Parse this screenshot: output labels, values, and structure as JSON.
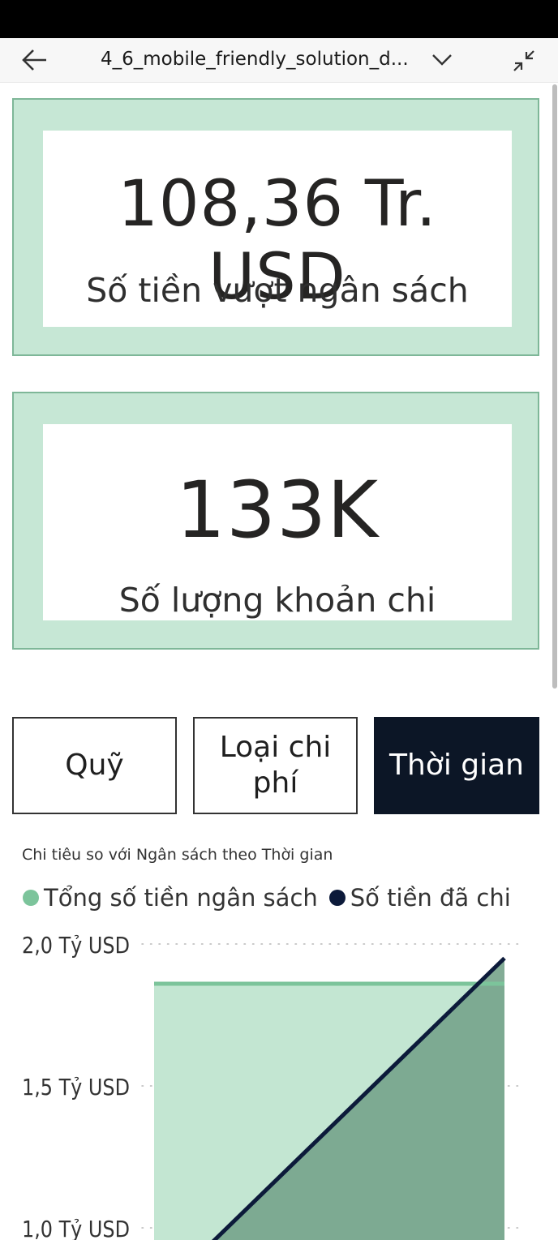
{
  "app": {
    "title": "4_6_mobile_friendly_solution_d...",
    "icons": {
      "back": "back-arrow-icon",
      "dropdown": "chevron-down-icon",
      "collapse": "collapse-icon"
    }
  },
  "kpis": [
    {
      "value": "108,36 Tr. USD",
      "label": "Số tiền vượt ngân sách"
    },
    {
      "value": "133K",
      "label": "Số lượng khoản chi"
    }
  ],
  "tabs": [
    {
      "label": "Quỹ",
      "active": false
    },
    {
      "label": "Loại chi phí",
      "active": false
    },
    {
      "label": "Thời gian",
      "active": true
    }
  ],
  "colors": {
    "card_bg": "#c6e7d5",
    "card_border": "#7eb798",
    "active_tab": "#0c1626",
    "budget": "#7cc49b",
    "spent": "#0c1a3a",
    "budget_fill": "#c3e6d2",
    "overlap_fill": "#76a38b"
  },
  "chart_data": {
    "type": "area",
    "title": "Chi tiêu so với Ngân sách theo Thời gian",
    "legend_position": "top-left",
    "y_tick_labels": [
      "2,0 Tỷ USD",
      "1,5 Tỷ USD",
      "1,0 Tỷ USD"
    ],
    "y_ticks": [
      2.0,
      1.5,
      1.0
    ],
    "y_visible_range": [
      0.97,
      2.05
    ],
    "gridlines": "dotted",
    "x_range": [
      0,
      1
    ],
    "series": [
      {
        "name": "Tổng số tiền ngân sách",
        "color": "#7cc49b",
        "points": [
          [
            0,
            1.86
          ],
          [
            1,
            1.86
          ]
        ]
      },
      {
        "name": "Số tiền đã chi",
        "color": "#0c1a3a",
        "points": [
          [
            0,
            0.75
          ],
          [
            1,
            1.95
          ]
        ]
      }
    ]
  }
}
